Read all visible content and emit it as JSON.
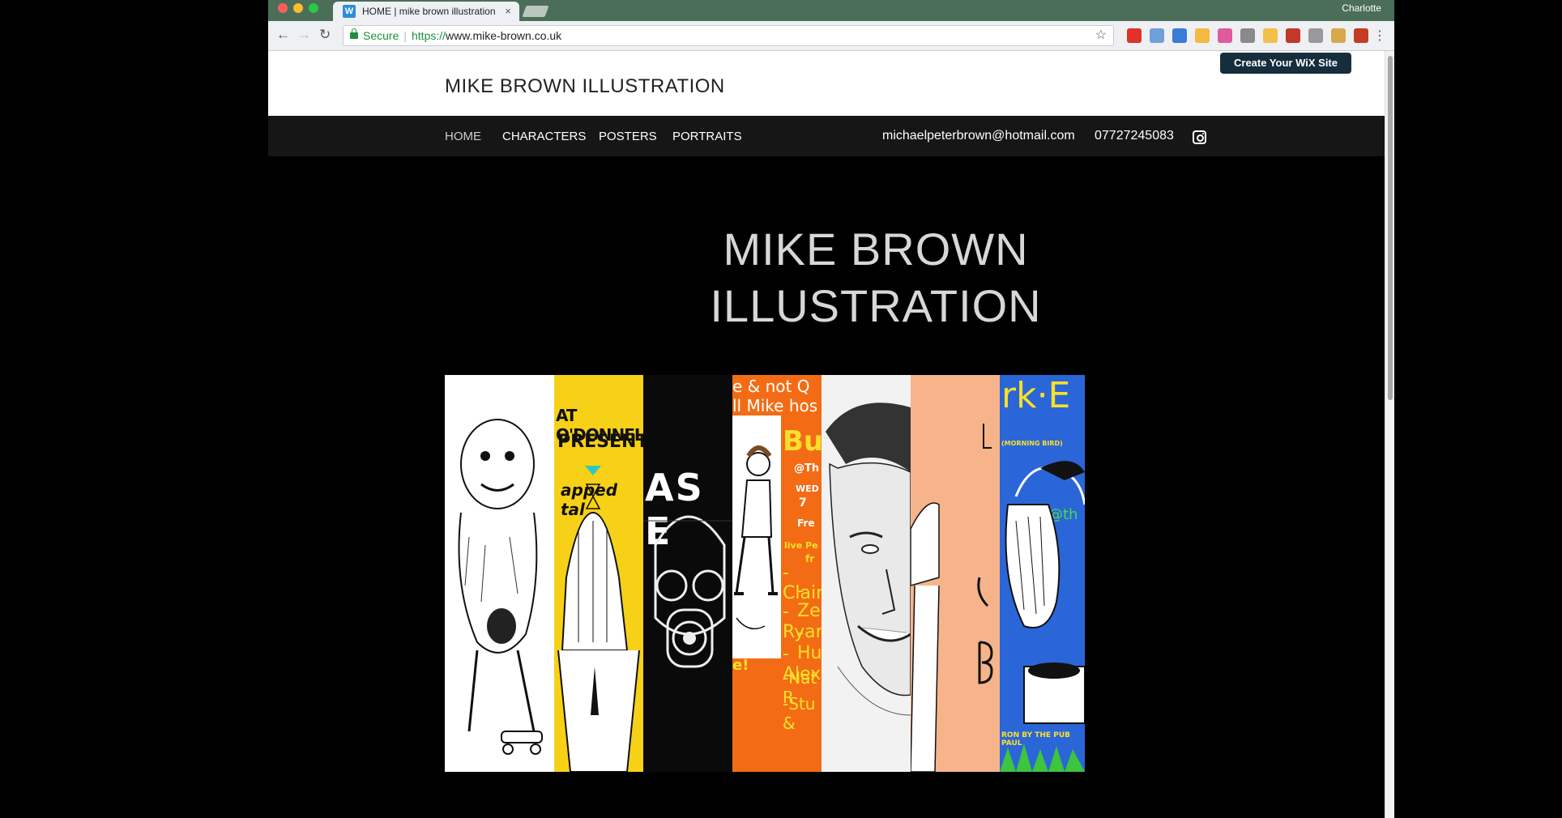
{
  "browser": {
    "tab_title": "HOME | mike brown illustration",
    "tab_close": "×",
    "profile_name": "Charlotte",
    "secure_label": "Secure",
    "url_scheme": "https://",
    "url_host": "www.mike-brown.co.uk",
    "back_icon": "←",
    "forward_icon": "→",
    "reload_icon": "↻",
    "bookmark_icon": "☆",
    "menu_icon": "⋮",
    "extension_colors": [
      "#e0322a",
      "#6fa0d8",
      "#3a7bd5",
      "#f5b942",
      "#e05b9c",
      "#8a8a8a",
      "#f0c04a",
      "#c0392b",
      "#999999",
      "#d7a84b",
      "#c23b22"
    ]
  },
  "wix_banner": {
    "label": "Create Your WiX Site"
  },
  "site": {
    "title": "MIKE BROWN ILLUSTRATION",
    "nav": {
      "home": "HOME",
      "characters": "CHARACTERS",
      "posters": "POSTERS",
      "portraits": "PORTRAITS",
      "email": "michaelpeterbrown@hotmail.com",
      "phone": "07727245083"
    },
    "hero": {
      "line1": "MIKE BROWN",
      "line2": "ILLUSTRATION"
    }
  },
  "gallery": {
    "strip_colors": [
      "#ffffff",
      "#f7d117",
      "#0a0a0a",
      "#f36c15",
      "#f2f2f2",
      "#f7b48a",
      "#2a66d8"
    ],
    "strip2_text": [
      "AT O'DONNELL",
      "PRESENTS",
      "apped tal"
    ],
    "strip3_text": "AS E",
    "strip4_text": [
      "e & not Q",
      "ll Mike hos",
      "Bu",
      "@Th",
      "WED",
      "7",
      "Fre",
      "live Pe",
      "fr",
      "-Clair",
      "-Ze",
      "-Ryan",
      "-Hu",
      "-Alex",
      "-Nat R",
      "-Stu &",
      "e!"
    ],
    "strip7_text": [
      "rk·E",
      "(MORNING BIRD)",
      "@th",
      "RON BY THE PUB PAUL"
    ]
  }
}
